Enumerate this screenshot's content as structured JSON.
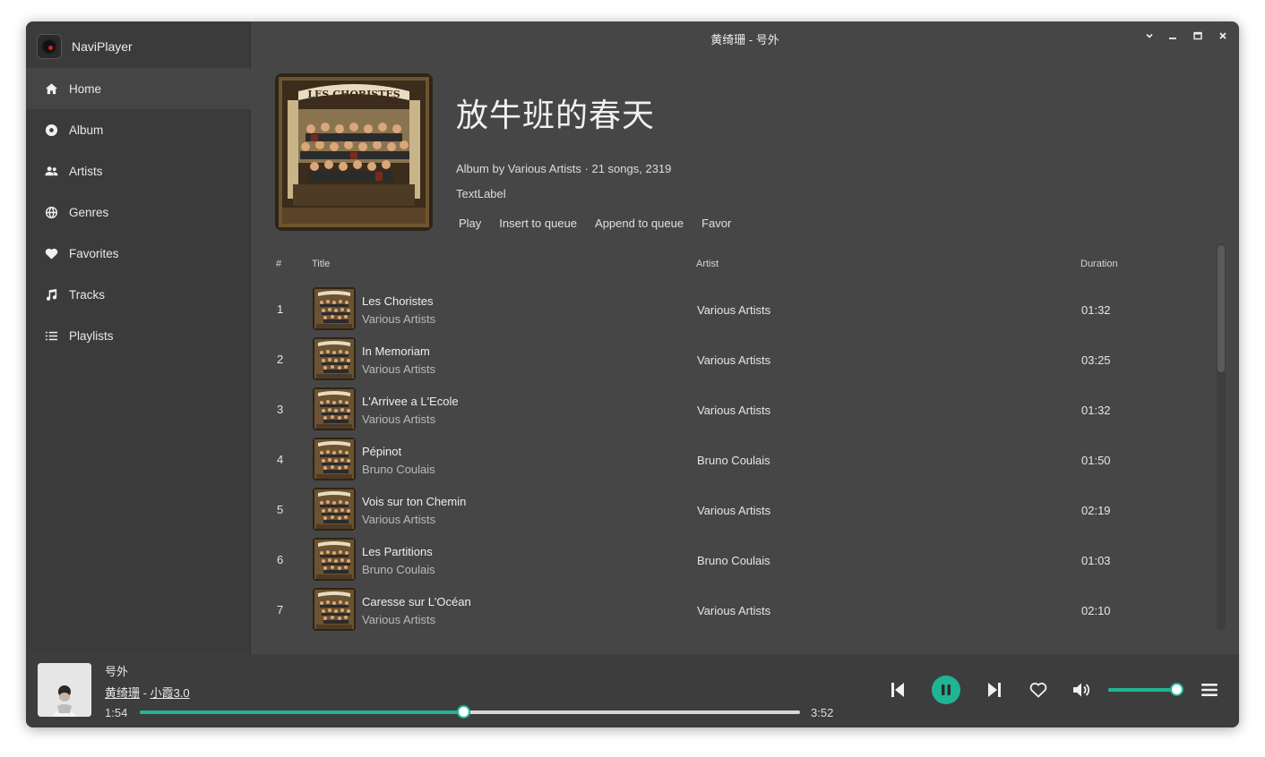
{
  "app": {
    "name": "NaviPlayer"
  },
  "window": {
    "title": "黄绮珊 - 号外"
  },
  "sidebar": {
    "items": [
      {
        "label": "Home",
        "icon": "home-icon",
        "active": true
      },
      {
        "label": "Album",
        "icon": "album-disc-icon"
      },
      {
        "label": "Artists",
        "icon": "artists-icon"
      },
      {
        "label": "Genres",
        "icon": "globe-icon"
      },
      {
        "label": "Favorites",
        "icon": "heart-icon"
      },
      {
        "label": "Tracks",
        "icon": "music-note-icon"
      },
      {
        "label": "Playlists",
        "icon": "list-icon"
      }
    ]
  },
  "album": {
    "title": "放牛班的春天",
    "meta": "Album by Various Artists · 21 songs, 2319",
    "label": "TextLabel",
    "actions": [
      "Play",
      "Insert to queue",
      "Append to queue",
      "Favor"
    ]
  },
  "table": {
    "headers": {
      "num": "#",
      "title": "Title",
      "artist": "Artist",
      "duration": "Duration"
    },
    "rows": [
      {
        "num": "1",
        "title": "Les Choristes",
        "subtitle": "Various Artists",
        "artist": "Various Artists",
        "duration": "01:32"
      },
      {
        "num": "2",
        "title": "In Memoriam",
        "subtitle": "Various Artists",
        "artist": "Various Artists",
        "duration": "03:25"
      },
      {
        "num": "3",
        "title": "L'Arrivee a L'Ecole",
        "subtitle": "Various Artists",
        "artist": "Various Artists",
        "duration": "01:32"
      },
      {
        "num": "4",
        "title": "Pépinot",
        "subtitle": "Bruno Coulais",
        "artist": "Bruno Coulais",
        "duration": "01:50"
      },
      {
        "num": "5",
        "title": "Vois sur ton Chemin",
        "subtitle": "Various Artists",
        "artist": "Various Artists",
        "duration": "02:19"
      },
      {
        "num": "6",
        "title": "Les Partitions",
        "subtitle": "Bruno Coulais",
        "artist": "Bruno Coulais",
        "duration": "01:03"
      },
      {
        "num": "7",
        "title": "Caresse sur L'Océan",
        "subtitle": "Various Artists",
        "artist": "Various Artists",
        "duration": "02:10"
      }
    ]
  },
  "player": {
    "title": "号外",
    "artist": "黄绮珊",
    "separator": " - ",
    "album": "小霞3.0",
    "current_time": "1:54",
    "total_time": "3:52",
    "progress_fraction": 0.49,
    "volume_fraction": 0.98,
    "accent_color": "#1fb594"
  }
}
